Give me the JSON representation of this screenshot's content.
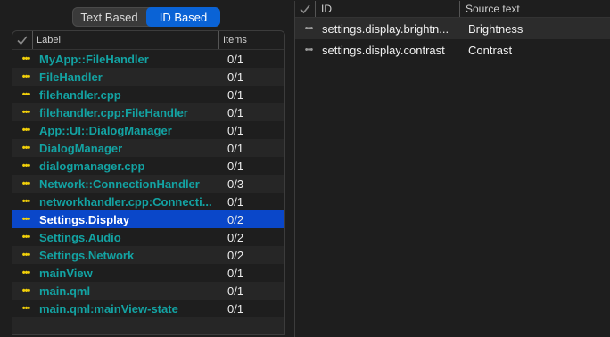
{
  "segmented": {
    "options": [
      "Text Based",
      "ID Based"
    ],
    "selected": "ID Based"
  },
  "left": {
    "columns": {
      "label": "Label",
      "items": "Items"
    },
    "rows": [
      {
        "label": "MyApp::FileHandler",
        "items": "0/1"
      },
      {
        "label": "FileHandler",
        "items": "0/1"
      },
      {
        "label": "filehandler.cpp",
        "items": "0/1"
      },
      {
        "label": "filehandler.cpp:FileHandler",
        "items": "0/1"
      },
      {
        "label": "App::UI::DialogManager",
        "items": "0/1"
      },
      {
        "label": "DialogManager",
        "items": "0/1"
      },
      {
        "label": "dialogmanager.cpp",
        "items": "0/1"
      },
      {
        "label": "Network::ConnectionHandler",
        "items": "0/3"
      },
      {
        "label": "networkhandler.cpp:Connecti...",
        "items": "0/1"
      },
      {
        "label": "Settings.Display",
        "items": "0/2",
        "selected": true
      },
      {
        "label": "Settings.Audio",
        "items": "0/2"
      },
      {
        "label": "Settings.Network",
        "items": "0/2"
      },
      {
        "label": "mainView",
        "items": "0/1"
      },
      {
        "label": "main.qml",
        "items": "0/1"
      },
      {
        "label": "main.qml:mainView-state",
        "items": "0/1"
      }
    ]
  },
  "right": {
    "columns": {
      "id": "ID",
      "source": "Source text"
    },
    "rows": [
      {
        "id": "settings.display.brightn...",
        "source": "Brightness"
      },
      {
        "id": "settings.display.contrast",
        "source": "Contrast"
      }
    ]
  },
  "icons": {
    "check": "checkmark-icon",
    "more": "more-dots-icon"
  },
  "colors": {
    "accent": "#0a63d6",
    "selection": "#0a47c9",
    "label": "#13a3a3",
    "dots": "#f2d00a"
  }
}
